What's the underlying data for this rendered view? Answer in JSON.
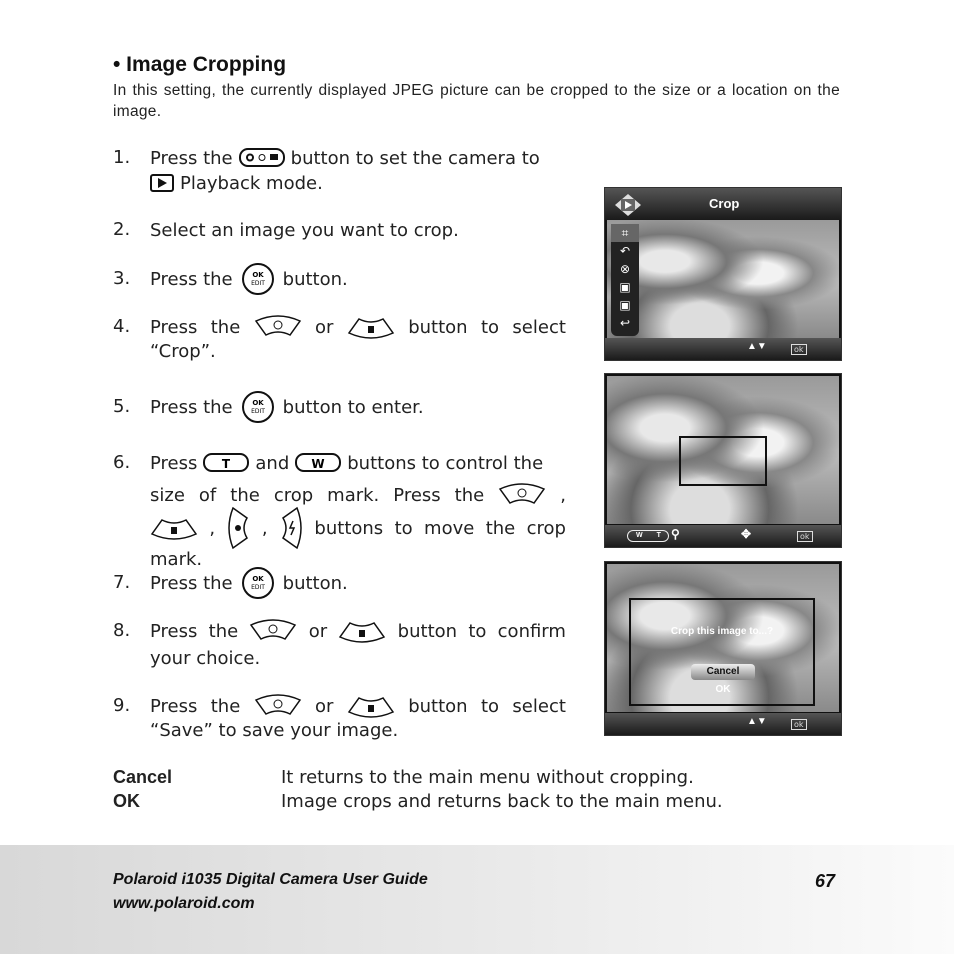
{
  "section": {
    "title": "• Image Cropping",
    "intro": "In this setting, the currently displayed JPEG picture can be cropped to the size or a location on the image."
  },
  "steps": [
    {
      "num": "1.",
      "lines": [
        [
          "Press the",
          "button to set the camera to"
        ],
        [
          "Playback mode."
        ]
      ]
    },
    {
      "num": "2.",
      "lines": [
        [
          "Select an image you want to crop."
        ]
      ]
    },
    {
      "num": "3.",
      "lines": [
        [
          "Press the",
          "button."
        ]
      ]
    },
    {
      "num": "4.",
      "lines": [
        [
          "Press",
          "the",
          "or",
          "button",
          "to",
          "select"
        ],
        [
          "“Crop”."
        ]
      ]
    },
    {
      "num": "5.",
      "lines": [
        [
          "Press the",
          "button to enter."
        ]
      ]
    },
    {
      "num": "6.",
      "lines": [
        [
          "Press",
          "and",
          "buttons to control the"
        ],
        [
          "size",
          "of",
          "the",
          "crop",
          "mark.",
          "Press",
          "the",
          ","
        ],
        [
          ",",
          ",",
          "buttons",
          "to",
          "move",
          "the",
          "crop"
        ],
        [
          "mark."
        ]
      ]
    },
    {
      "num": "7.",
      "lines": [
        [
          "Press the",
          "button."
        ]
      ]
    },
    {
      "num": "8.",
      "lines": [
        [
          "Press",
          "the",
          "or",
          "button",
          "to",
          "confirm"
        ],
        [
          "your choice."
        ]
      ]
    },
    {
      "num": "9.",
      "lines": [
        [
          "Press",
          "the",
          "or",
          "button",
          "to",
          "select"
        ],
        [
          "“Save” to save your image."
        ]
      ]
    }
  ],
  "definitions": [
    {
      "term": "Cancel",
      "desc": "It returns to the main menu without cropping."
    },
    {
      "term": "OK",
      "desc": "Image crops and returns back to the main menu."
    }
  ],
  "icons": {
    "mode": "mode-button-icon",
    "ok": "ok-edit-button-icon",
    "up": "self-timer-up-button-icon",
    "down": "delete-down-button-icon",
    "left": "macro-left-button-icon",
    "right": "flash-right-button-icon",
    "t": "T",
    "w": "W",
    "play": "playback-icon"
  },
  "screens": {
    "menu": {
      "title": "Crop",
      "ok": "ok"
    },
    "crop": {
      "w": "W",
      "t": "T",
      "ok": "ok"
    },
    "confirm": {
      "question": "Crop this image to...?",
      "options": [
        "Cancel",
        "OK"
      ],
      "ok": "ok"
    }
  },
  "footer": {
    "guide": "Polaroid i1035 Digital Camera User Guide",
    "url": "www.polaroid.com",
    "page": "67"
  }
}
